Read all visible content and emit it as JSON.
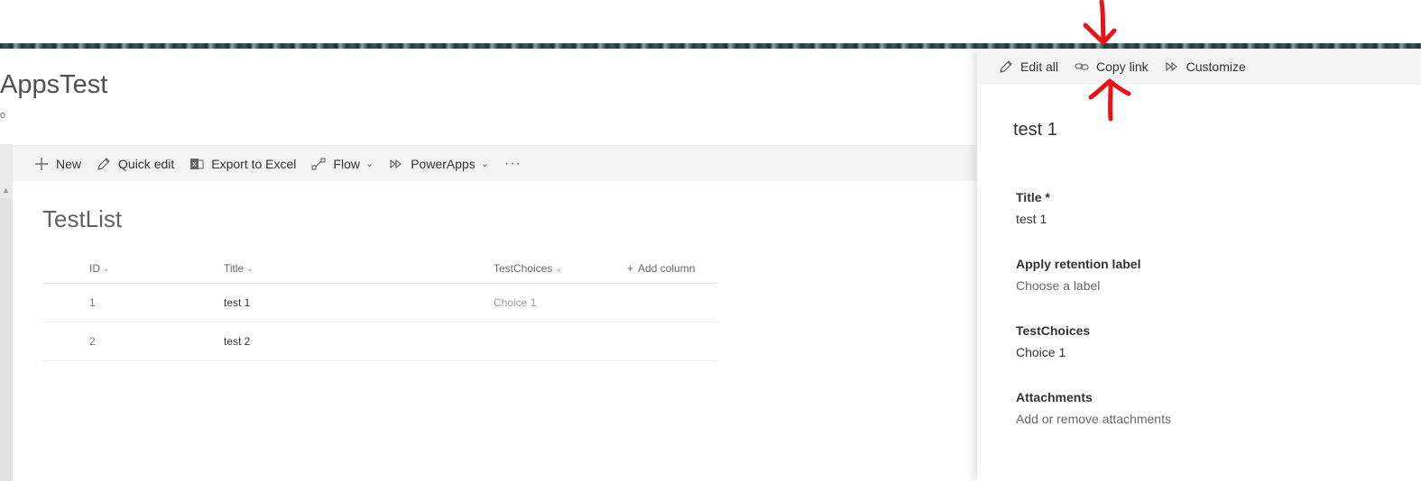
{
  "site": {
    "title": "AppsTest",
    "subtitle": "o"
  },
  "command_bar": {
    "new": "New",
    "quick_edit": "Quick edit",
    "export": "Export to Excel",
    "flow": "Flow",
    "powerapps": "PowerApps",
    "more": "···"
  },
  "list": {
    "title": "TestList",
    "columns": [
      "ID",
      "Title",
      "TestChoices"
    ],
    "add_column": "Add column",
    "rows": [
      {
        "id": "1",
        "title": "test 1",
        "choice": "Choice 1"
      },
      {
        "id": "2",
        "title": "test 2",
        "choice": ""
      }
    ]
  },
  "panel": {
    "toolbar": {
      "edit_all": "Edit all",
      "copy_link": "Copy link",
      "customize": "Customize"
    },
    "item_title": "test 1",
    "fields": [
      {
        "label": "Title *",
        "value": "test 1"
      },
      {
        "label": "Apply retention label",
        "value": "Choose a label"
      },
      {
        "label": "TestChoices",
        "value": "Choice 1"
      },
      {
        "label": "Attachments",
        "value": "Add or remove attachments"
      }
    ]
  },
  "colors": {
    "banner": "#1f3a36",
    "command_bar": "#f4f4f4",
    "annotation": "#e8121a"
  }
}
